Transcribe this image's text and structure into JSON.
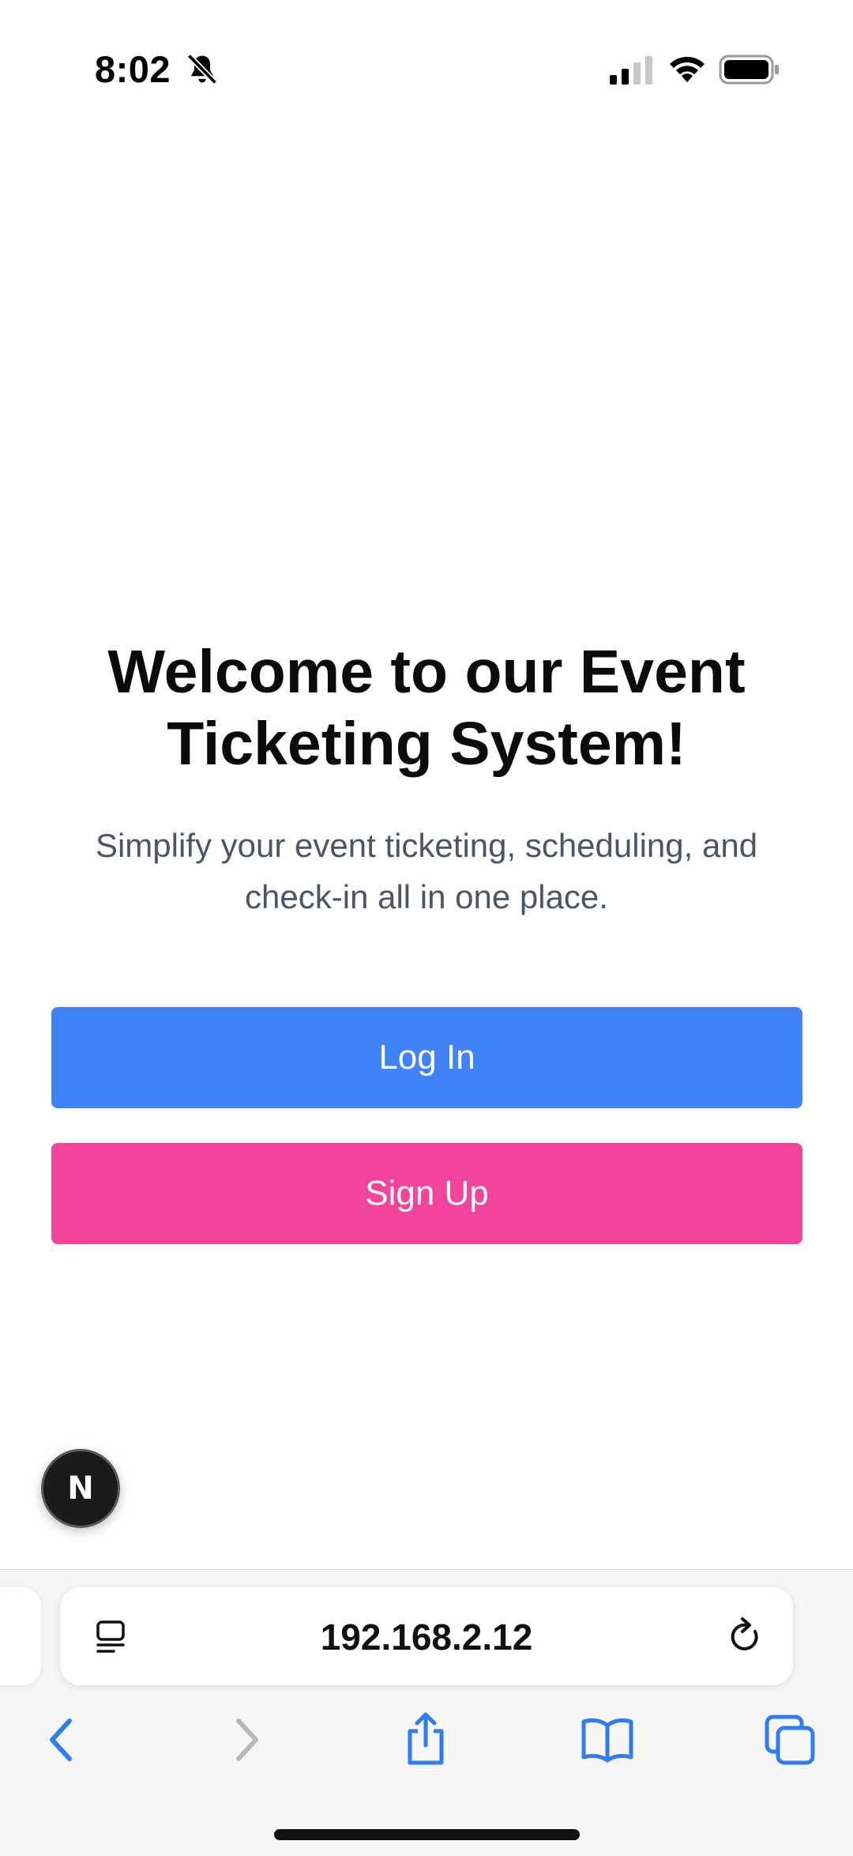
{
  "status_bar": {
    "time": "8:02",
    "icons": [
      "bell-slash-icon",
      "cellular-signal-icon",
      "wifi-icon",
      "battery-icon"
    ]
  },
  "hero": {
    "title": "Welcome to our Event Ticketing System!",
    "subtitle": "Simplify your event ticketing, scheduling, and check-in all in one place."
  },
  "actions": {
    "login_label": "Log In",
    "signup_label": "Sign Up"
  },
  "dev_badge": {
    "label": "N"
  },
  "browser": {
    "url": "192.168.2.12",
    "toolbar_icons": [
      "back-icon",
      "forward-icon",
      "share-icon",
      "bookmarks-icon",
      "tabs-icon"
    ]
  },
  "colors": {
    "login_button": "#4182f9",
    "signup_button": "#f2449b",
    "title_text": "#0b0b0b",
    "subtitle_text": "#4b5563",
    "browser_accent": "#2f7cf6"
  }
}
